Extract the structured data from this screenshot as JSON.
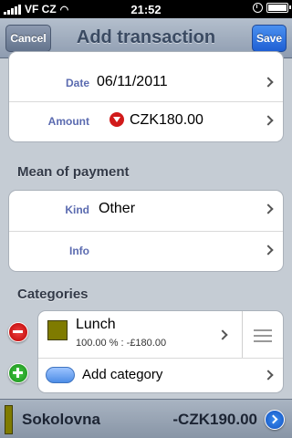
{
  "status_bar": {
    "carrier": "VF CZ",
    "time": "21:52"
  },
  "nav": {
    "title": "Add transaction",
    "cancel_label": "Cancel",
    "save_label": "Save"
  },
  "details": {
    "date_label": "Date",
    "date_value": "06/11/2011",
    "amount_label": "Amount",
    "amount_value": "CZK180.00"
  },
  "payment": {
    "section_title": "Mean of payment",
    "kind_label": "Kind",
    "kind_value": "Other",
    "info_label": "Info",
    "info_value": ""
  },
  "categories": {
    "section_title": "Categories",
    "items": [
      {
        "name": "Lunch",
        "detail": "100.00 % : -£180.00",
        "color": "#7f7b00"
      }
    ],
    "add_label": "Add category"
  },
  "bottom_bar": {
    "name": "Sokolovna",
    "amount": "-CZK190.00",
    "color": "#7f7b00"
  },
  "colors": {
    "label_blue": "#5b6bb0",
    "save_blue": "#2a6fe0",
    "amount_down_red": "#d11a1a"
  }
}
